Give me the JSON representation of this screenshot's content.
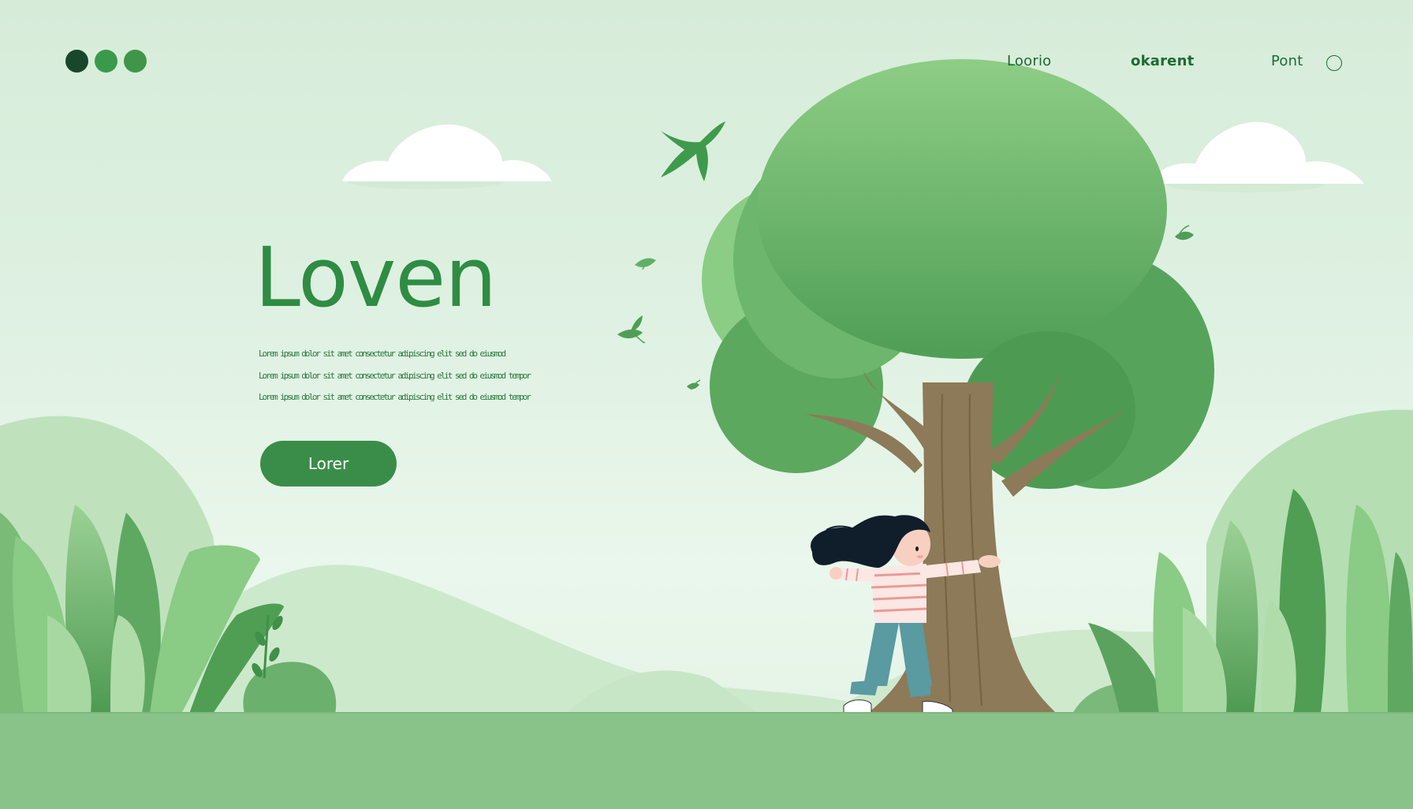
{
  "header": {
    "window_dots": [
      {
        "color": "#18472c"
      },
      {
        "color": "#3a9a4b"
      },
      {
        "color": "#3f9648"
      }
    ],
    "nav": {
      "loorio": "Loorio",
      "okarent": "okarent",
      "pont": "Pont"
    },
    "toggle_icon": "circle-icon"
  },
  "hero": {
    "title": "Loven",
    "body_lines": [
      "Lorem ipsum dolor sit amet consectetur adipiscing elit sed do eiusmod",
      "Lorem ipsum dolor sit amet consectetur adipiscing elit sed do eiusmod tempor",
      "Lorem ipsum dolor sit amet consectetur adipiscing elit sed do eiusmod tempor"
    ],
    "button_label": "Lorer"
  },
  "illustration": {
    "elements": [
      "cloud-icon",
      "bird-icon",
      "leaf-icon",
      "tree",
      "girl-hugging-tree",
      "bushes",
      "hills"
    ]
  },
  "colors": {
    "accent": "#3a8d48",
    "title": "#2f8c43",
    "ground": "#8ac38a",
    "foliage": "#5da65f",
    "trunk": "#8d7a58"
  }
}
